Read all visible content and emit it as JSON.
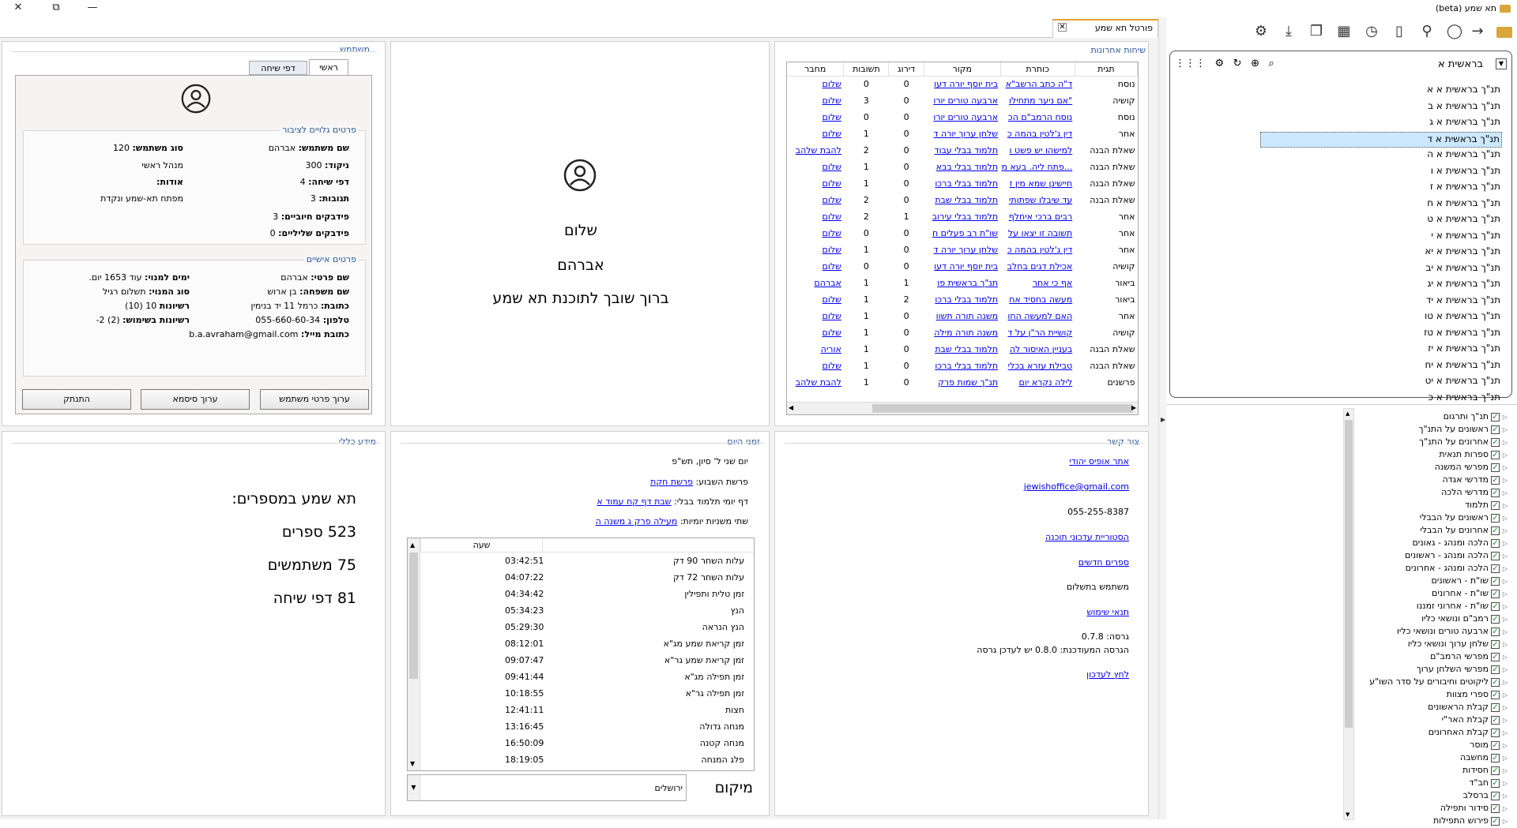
{
  "window": {
    "title": "תא שמע (beta)",
    "controls": {
      "close": "✕",
      "restore": "⧉",
      "minimize": "—"
    }
  },
  "tab": {
    "label": "פורטל תא שמע",
    "close": "✕"
  },
  "recent": {
    "title": "שיחות אחרונות",
    "headers": [
      "תגית",
      "כותרת",
      "מקור",
      "דירוג",
      "תשובות",
      "מחבר"
    ],
    "rows": [
      [
        "נוסח",
        "ד\"ה כתב הרשב\"א",
        "בית יוסף יורה דעו",
        "0",
        "0",
        "שלום"
      ],
      [
        "קושיה",
        "\"אם ניער מתחילו",
        "ארבעה טורים יורו",
        "0",
        "3",
        "שלום"
      ],
      [
        "נוסח",
        "נוסח הרמב\"ם הכ",
        "ארבעה טורים יורו",
        "0",
        "0",
        "שלום"
      ],
      [
        "אחר",
        "דין ג'לטין בהמה כ",
        "שלחן ערוך יורה ד",
        "0",
        "1",
        "שלום"
      ],
      [
        "שאלת הבנה",
        "למישהו יש פשט ו",
        "תלמוד בבלי עבוד",
        "0",
        "2",
        "להבת שלהב"
      ],
      [
        "שאלת הבנה",
        "...פתח ליה. בעא מ",
        "תלמוד בבלי בבא",
        "0",
        "1",
        "שלום"
      ],
      [
        "שאלת הבנה",
        "חיישינן שמא מין ז",
        "תלמוד בבלי ברכו",
        "0",
        "1",
        "שלום"
      ],
      [
        "שאלת הבנה",
        "עד שיבלו שפתותי",
        "תלמוד בבלי שבת",
        "0",
        "2",
        "שלום"
      ],
      [
        "אחר",
        "רבים ברכי איחלף",
        "תלמוד בבלי עירוב",
        "1",
        "2",
        "שלום"
      ],
      [
        "אחר",
        "תשובה זו יצאו על",
        "שו\"ת רב פעלים ח",
        "0",
        "0",
        "שלום"
      ],
      [
        "אחר",
        "דין ג'לטין בהמה כ",
        "שלחן ערוך יורה ד",
        "0",
        "1",
        "שלום"
      ],
      [
        "קושיה",
        "אכילת דגים בחלב",
        "בית יוסף יורה דעו",
        "0",
        "0",
        "שלום"
      ],
      [
        "ביאור",
        "אף כי אחר",
        "תנ\"ך בראשית פו",
        "1",
        "1",
        "אברהם"
      ],
      [
        "ביאור",
        "מעשה בחסיד אח",
        "תלמוד בבלי ברכו",
        "2",
        "1",
        "שלום"
      ],
      [
        "אחר",
        "האם למעשה החו",
        "משנה תורה תשוו",
        "0",
        "1",
        "שלום"
      ],
      [
        "קושיה",
        "קושיית הר\"ן על ד",
        "משנה תורה מילה",
        "0",
        "1",
        "שלום"
      ],
      [
        "שאלת הבנה",
        "בעניין האיסור לה",
        "תלמוד בבלי שבת",
        "0",
        "1",
        "אוריה"
      ],
      [
        "שאלת הבנה",
        "טבילת עזרא בכלי",
        "תלמוד בבלי ברכו",
        "0",
        "1",
        "שלום"
      ],
      [
        "פרשנים",
        "לילה נקרא יום",
        "תנ\"ך שמות פרק",
        "0",
        "1",
        "להבת שלהב"
      ]
    ]
  },
  "welcome": {
    "line1": "שלום",
    "line2": "אברהם",
    "line3": "ברוך שובך לתוכנת תא שמע"
  },
  "user": {
    "title": "משתמש",
    "tabs": [
      "ראשי",
      "דפי שיחה"
    ],
    "public_title": "פרטים גלויים לציבור",
    "public": {
      "name_label": "שם משתמש:",
      "name": "אברהם",
      "type_label": "סוג משתמש:",
      "type": "120",
      "points_label": "ניקוד:",
      "points": "300",
      "role": "מנהל ראשי",
      "pages_label": "דפי שיחה:",
      "pages": "4",
      "about_label": "אודות:",
      "replies_label": "תגובות:",
      "replies": "3",
      "about": "מפתח תא-שמע ונקדת",
      "pos_label": "פידבקים חיוביים:",
      "pos": "3",
      "neg_label": "פידבקים שליליים:",
      "neg": "0"
    },
    "personal_title": "פרטים אישיים",
    "personal": {
      "first_label": "שם פרטי:",
      "first": "אברהם",
      "days_label": "ימים למנוי:",
      "days": "עוד 1653 יום.",
      "last_label": "שם משפחה:",
      "last": "בן ארוש",
      "sub_label": "סוג המנוי:",
      "sub": "תשלום רגיל",
      "addr_label": "כתובת:",
      "addr": "כרמל 11 יד בנימין",
      "lic_label": "רשיונות",
      "lic": "10 (10)",
      "phone_label": "טלפון:",
      "phone": "055-660-60-34",
      "used_label": "רשיונות בשימוש:",
      "used": "(2) 2-",
      "mail_label": "כתובת מייל:",
      "mail": "b.a.avraham@gmail.com"
    },
    "buttons": {
      "edit": "ערוך פרטי משתמש",
      "password": "ערוך סיסמא",
      "logout": "התנתק"
    }
  },
  "contact": {
    "title": "צור קשר",
    "site": "אתר אופיס יהודי",
    "email": "jewishoffice@gmail.com",
    "phone": "055-255-8387",
    "history": "הסטוריית עדכוני תוכנה",
    "newbooks": "ספרים חדשים",
    "paid": "משתמש בתשלום",
    "terms": "תנאי שימוש",
    "version": "גרסה: 0.7.8",
    "update": "הגרסה המעודכנת: 0.8.0 יש לעדכן גרסה",
    "update_link": "לחץ לעדכון"
  },
  "zmanim": {
    "title": "זמני היום",
    "date": "יום שני ל' סיון, תש\"פ",
    "parasha_label": "פרשת השבוע:",
    "parasha": "פרשת חקת",
    "daf_label": "דף יומי תלמוד בבלי:",
    "daf": "שבת דף קח עמוד א",
    "mishna_label": "שתי משניות יומיות:",
    "mishna": "מעילה פרק ג משנה ה",
    "col_hour": "שעה",
    "rows": [
      [
        "עלות השחר 90 דק",
        "03:42:51"
      ],
      [
        "עלות השחר 72 דק",
        "04:07:22"
      ],
      [
        "זמן טלית ותפילין",
        "04:34:42"
      ],
      [
        "הנץ",
        "05:34:23"
      ],
      [
        "הנץ הנראה",
        "05:29:30"
      ],
      [
        "זמן קריאת שמע מג\"א",
        "08:12:01"
      ],
      [
        "זמן קריאת שמע גר\"א",
        "09:07:47"
      ],
      [
        "זמן תפילה מג\"א",
        "09:41:44"
      ],
      [
        "זמן תפילה גר\"א",
        "10:18:55"
      ],
      [
        "חצות",
        "12:41:11"
      ],
      [
        "מנחה גדולה",
        "13:16:45"
      ],
      [
        "מנחה קטנה",
        "16:50:09"
      ],
      [
        "פלג המנחה",
        "18:19:05"
      ]
    ],
    "location_label": "מיקום",
    "location": "ירושלים"
  },
  "info": {
    "title": "מידע כללי",
    "head": "תא שמע במספרים:",
    "books": "523 ספרים",
    "users": "75 משתמשים",
    "pages": "81 דפי שיחה"
  },
  "book": {
    "title": "בראשית א",
    "items": [
      "תנ\"ך בראשית א א",
      "תנ\"ך בראשית א ב",
      "תנ\"ך בראשית א ג",
      "תנ\"ך בראשית א ד",
      "תנ\"ך בראשית א ה",
      "תנ\"ך בראשית א ו",
      "תנ\"ך בראשית א ז",
      "תנ\"ך בראשית א ח",
      "תנ\"ך בראשית א ט",
      "תנ\"ך בראשית א י",
      "תנ\"ך בראשית א יא",
      "תנ\"ך בראשית א יב",
      "תנ\"ך בראשית א יג",
      "תנ\"ך בראשית א יד",
      "תנ\"ך בראשית א טו",
      "תנ\"ך בראשית א טז",
      "תנ\"ך בראשית א יז",
      "תנ\"ך בראשית א יח",
      "תנ\"ך בראשית א יט",
      "תנ\"ך בראשית א כ"
    ],
    "selected_index": 3
  },
  "categories": [
    "תנ\"ך ותרגום",
    "ראשונים על התנ\"ך",
    "אחרונים על התנ\"ך",
    "ספרות תנאית",
    "מפרשי המשנה",
    "מדרשי אגדה",
    "מדרשי הלכה",
    "תלמוד",
    "ראשונים על הבבלי",
    "אחרונים על הבבלי",
    "הלכה ומנהג - גאונים",
    "הלכה ומנהג - ראשונים",
    "הלכה ומנהג - אחרונים",
    "שו\"ת - ראשונים",
    "שו\"ת - אחרונים",
    "שו\"ת - אחרוני זמננו",
    "רמב\"ם ונושאי כליו",
    "ארבעה טורים ונושאי כליו",
    "שלחן ערוך ונושאי כליו",
    "מפרשי הרמב\"ם",
    "מפרשי השלחן ערוך",
    "ליקוטים וחיבורים על סדר השו\"ע",
    "ספרי מצוות",
    "קבלת הראשונים",
    "קבלת האר\"י",
    "קבלת האחרונים",
    "מוסר",
    "מחשבה",
    "חסידות",
    "חב\"ד",
    "ברסלב",
    "סידור ותפילה",
    "פירוש התפילות"
  ],
  "toolbar_icons": [
    "back-arrow-icon",
    "profile-icon",
    "search-user-icon",
    "bookmark-icon",
    "history-icon",
    "calendar-icon",
    "windows-icon",
    "download-icon",
    "settings-icon"
  ],
  "colors": {
    "accent": "#e1a32c",
    "group_title": "#2b5a9a",
    "link": "#0000ee",
    "check": "#2a8a2a"
  }
}
